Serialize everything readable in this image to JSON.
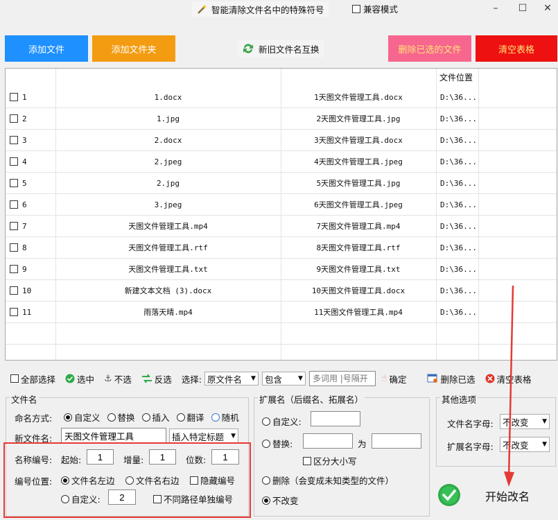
{
  "title": {
    "app_title": "智能清除文件名中的特殊符号",
    "compat_label": "兼容模式"
  },
  "window": {
    "minimize": "–",
    "maximize": "☐",
    "close": "✕"
  },
  "buttons": {
    "add_file": "添加文件",
    "add_folder": "添加文件夹",
    "swap_names": "新旧文件名互换",
    "delete_selected": "删除已选的文件",
    "clear_table": "清空表格"
  },
  "colors": {
    "add_file": "#1e90ff",
    "add_folder": "#f39c12",
    "delete_selected": "#f7668e",
    "clear_table": "#ee1111",
    "annotation": "#e53935"
  },
  "table": {
    "headers": {
      "col_location": "文件位置"
    },
    "rows": [
      {
        "num": "1",
        "old": "1.docx",
        "new": "1天图文件管理工具.docx",
        "loc": "D:\\36..."
      },
      {
        "num": "2",
        "old": "1.jpg",
        "new": "2天图文件管理工具.jpg",
        "loc": "D:\\36..."
      },
      {
        "num": "3",
        "old": "2.docx",
        "new": "3天图文件管理工具.docx",
        "loc": "D:\\36..."
      },
      {
        "num": "4",
        "old": "2.jpeg",
        "new": "4天图文件管理工具.jpeg",
        "loc": "D:\\36..."
      },
      {
        "num": "5",
        "old": "2.jpg",
        "new": "5天图文件管理工具.jpg",
        "loc": "D:\\36..."
      },
      {
        "num": "6",
        "old": "3.jpeg",
        "new": "6天图文件管理工具.jpeg",
        "loc": "D:\\36..."
      },
      {
        "num": "7",
        "old": "天图文件管理工具.mp4",
        "new": "7天图文件管理工具.mp4",
        "loc": "D:\\36..."
      },
      {
        "num": "8",
        "old": "天图文件管理工具.rtf",
        "new": "8天图文件管理工具.rtf",
        "loc": "D:\\36..."
      },
      {
        "num": "9",
        "old": "天图文件管理工具.txt",
        "new": "9天图文件管理工具.txt",
        "loc": "D:\\36..."
      },
      {
        "num": "10",
        "old": "新建文本文档 (3).docx",
        "new": "10天图文件管理工具.docx",
        "loc": "D:\\36..."
      },
      {
        "num": "11",
        "old": "雨落天晴.mp4",
        "new": "11天图文件管理工具.mp4",
        "loc": "D:\\36..."
      }
    ]
  },
  "toolbar": {
    "select_all": "全部选择",
    "select": "选中",
    "deselect": "不选",
    "invert": "反选",
    "choose_label": "选择:",
    "field_value": "原文件名",
    "op_value": "包含",
    "keyword_placeholder": "多词用 |号隔开",
    "confirm": "确定",
    "delete_selected": "删除已选",
    "clear_table": "清空表格"
  },
  "filename": {
    "group_title": "文件名",
    "mode_label": "命名方式:",
    "modes": [
      "自定义",
      "替换",
      "插入",
      "翻译",
      "随机"
    ],
    "new_name_label": "新文件名:",
    "new_name_value": "天图文件管理工具",
    "insert_title": "插入特定标题",
    "numbering_label": "名称编号:",
    "start_label": "起始:",
    "start_value": "1",
    "step_label": "增量:",
    "step_value": "1",
    "digits_label": "位数:",
    "digits_value": "1",
    "position_label": "编号位置:",
    "pos_left": "文件名左边",
    "pos_right": "文件名右边",
    "hide_num": "隐藏编号",
    "custom": "自定义:",
    "custom_value": "2",
    "per_path": "不同路径单独编号"
  },
  "extension": {
    "group_title": "扩展名（后缀名、拓展名）",
    "custom": "自定义:",
    "replace": "替换:",
    "replace_with": "为",
    "case_sensitive": "区分大小写",
    "delete": "删除（会变成未知类型的文件）",
    "unchanged": "不改变"
  },
  "other": {
    "group_title": "其他选项",
    "name_case_label": "文件名字母:",
    "name_case_value": "不改变",
    "ext_case_label": "扩展名字母:",
    "ext_case_value": "不改变"
  },
  "start": {
    "label": "开始改名"
  }
}
